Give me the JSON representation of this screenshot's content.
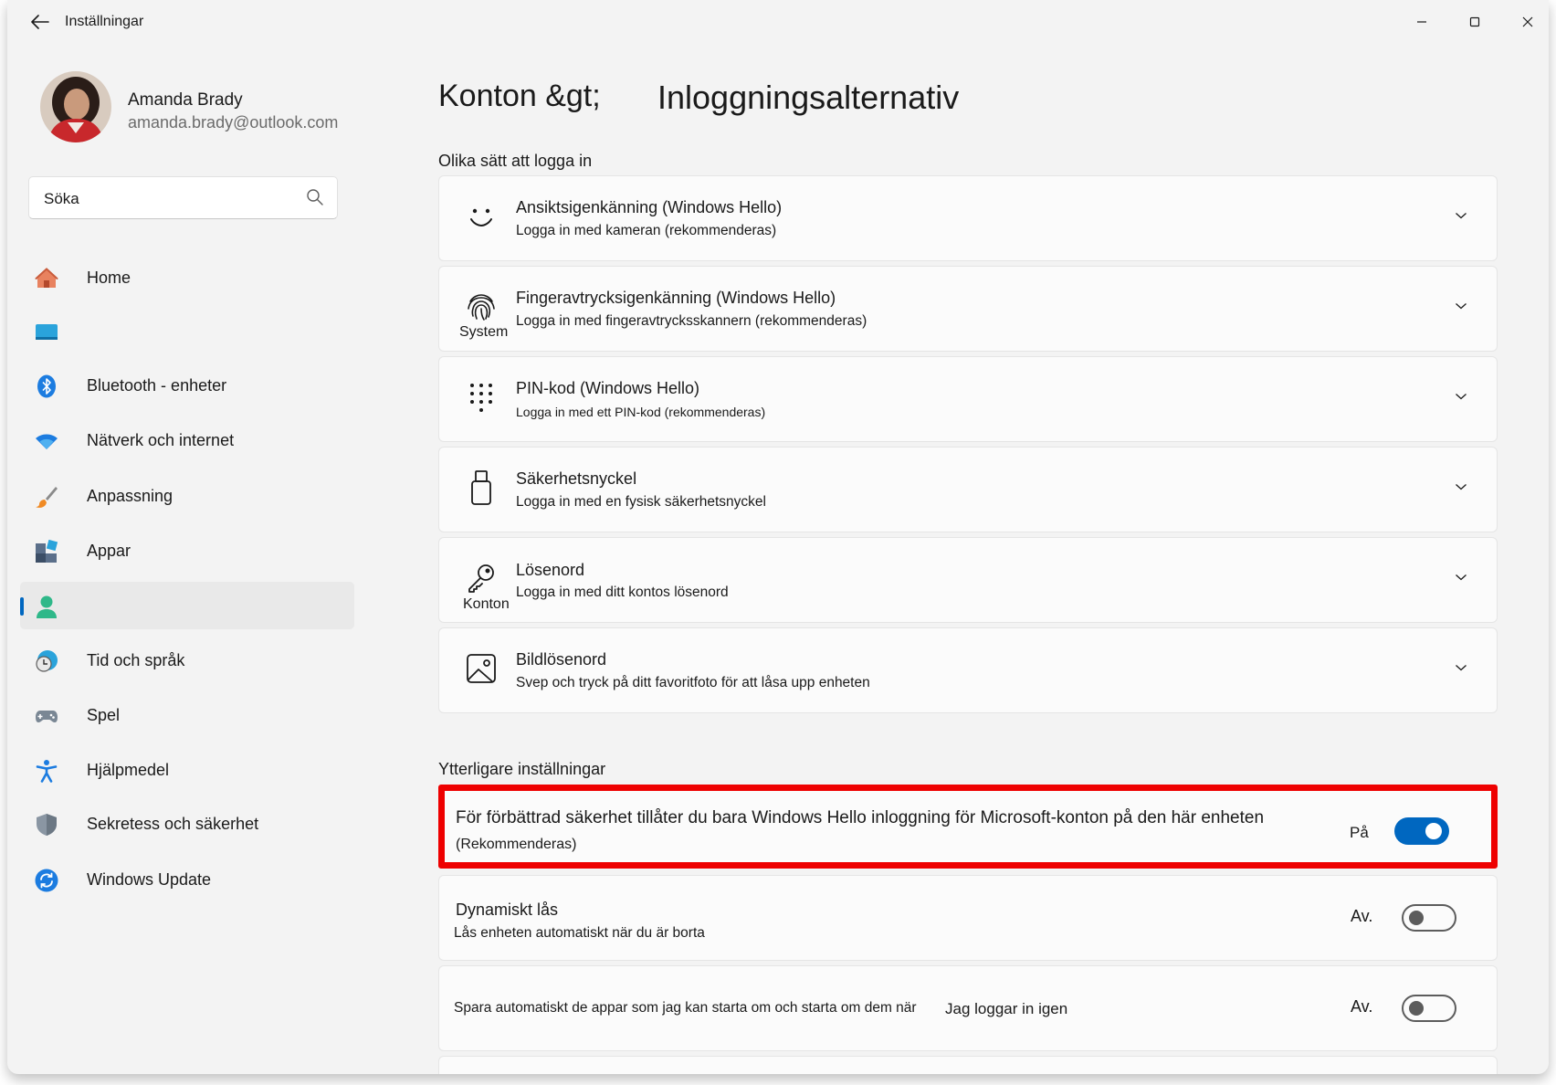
{
  "window": {
    "title": "Inställningar"
  },
  "profile": {
    "name": "Amanda Brady",
    "email": "amanda.brady@outlook.com"
  },
  "search": {
    "placeholder": "Söka"
  },
  "nav": {
    "home": "Home",
    "system": "",
    "bluetooth": "Bluetooth - enheter",
    "network": "Nätverk och internet",
    "personalization": "Anpassning",
    "apps": "Appar",
    "accounts": "",
    "time_language": "Tid och språk",
    "gaming": "Spel",
    "accessibility": "Hjälpmedel",
    "privacy": "Sekretess och säkerhet",
    "windows_update": "Windows Update"
  },
  "breadcrumb": {
    "parent": "Konton &gt;",
    "current": "Inloggningsalternativ"
  },
  "sign_in": {
    "section_title": "Olika sätt att logga in",
    "options": [
      {
        "title": "Ansiktsigenkänning (Windows Hello)",
        "subtitle": "Logga in med kameran (rekommenderas)",
        "icon": "face-icon"
      },
      {
        "title": "Fingeravtrycksigenkänning (Windows Hello)",
        "subtitle": "Logga in med fingeravtrycksskannern (rekommenderas)",
        "icon": "fingerprint-icon"
      },
      {
        "title": "PIN-kod (Windows Hello)",
        "subtitle": "Logga in med ett  PIN-kod (rekommenderas)",
        "icon": "pin-keypad-icon"
      },
      {
        "title": "Säkerhetsnyckel",
        "subtitle": "Logga in med en fysisk säkerhetsnyckel",
        "icon": "usb-key-icon"
      },
      {
        "title": "Lösenord",
        "subtitle": "Logga in med ditt kontos lösenord",
        "icon": "key-icon"
      },
      {
        "title": "Bildlösenord",
        "subtitle": "Svep och tryck på ditt favoritfoto för att låsa upp enheten",
        "icon": "picture-icon"
      }
    ],
    "stray_labels": {
      "system": "System",
      "konton": "Konton"
    }
  },
  "additional": {
    "section_title": "Ytterligare inställningar",
    "hello_only": {
      "title": "För förbättrad säkerhet tillåter du bara Windows Hello inloggning för Microsoft-konton på den här enheten",
      "subtitle": "(Rekommenderas)",
      "state_label": "På",
      "on": true
    },
    "dynamic_lock": {
      "title": "Dynamiskt lås",
      "subtitle": "Lås enheten automatiskt när du är borta",
      "state_label": "Av.",
      "on": false
    },
    "restart_apps": {
      "title": "Spara automatiskt de appar som jag kan starta om och starta om dem när",
      "title_suffix": "Jag loggar in igen",
      "state_label": "Av.",
      "on": false
    }
  },
  "colors": {
    "accent": "#0067c0",
    "highlight": "#ee0000",
    "background": "#f3f3f3",
    "card": "#fbfbfb"
  }
}
